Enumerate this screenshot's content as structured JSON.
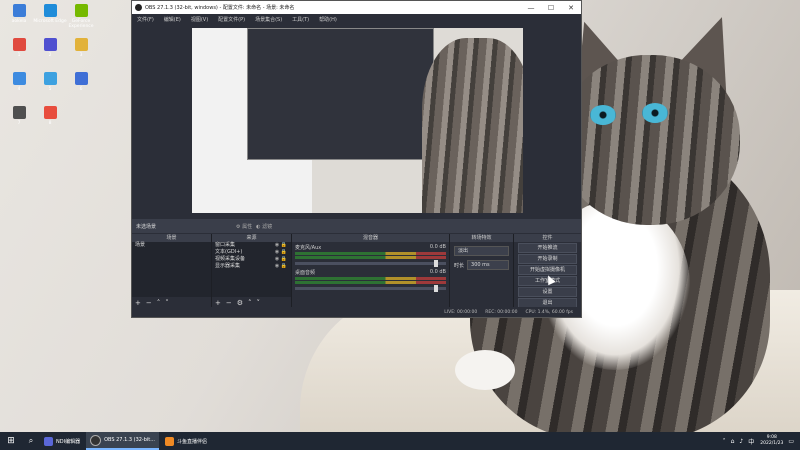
{
  "desktop": {
    "icons": [
      {
        "label": "aokela",
        "color": "#3b7dd8"
      },
      {
        "label": "Microsoft Edge",
        "color": "#1f8cd9"
      },
      {
        "label": "GeForce Experience",
        "color": "#76b900"
      },
      {
        "label": "1",
        "color": "#e04a3f"
      },
      {
        "label": "2",
        "color": "#5050d0"
      },
      {
        "label": "3",
        "color": "#e2b23a"
      },
      {
        "label": "4",
        "color": "#3d8be0"
      },
      {
        "label": "5",
        "color": "#3da1e0"
      },
      {
        "label": "6",
        "color": "#3f6fd6"
      },
      {
        "label": "7",
        "color": "#4f4f4f"
      },
      {
        "label": "8",
        "color": "#e84d3d"
      }
    ]
  },
  "obs": {
    "title": "OBS 27.1.3 (32-bit, windows) - 配置文件: 未命名 - 场景: 未命名",
    "controls": [
      "—",
      "☐",
      "✕"
    ],
    "menu": [
      "文件(F)",
      "编辑(E)",
      "视图(V)",
      "配置文件(P)",
      "场景集合(S)",
      "工具(T)",
      "帮助(H)"
    ],
    "current_scene_label": "未选场景",
    "scene_buttons": [
      "属性",
      "滤镜"
    ],
    "panels": {
      "scenes": {
        "header": "场景",
        "items": [
          "场景"
        ]
      },
      "sources": {
        "header": "来源",
        "items": [
          "窗口采集",
          "文本(GDI+)",
          "视频采集设备",
          "显示器采集"
        ]
      },
      "mixer": {
        "header": "混音器",
        "channels": [
          {
            "name": "麦克风/Aux",
            "db": "0.0 dB"
          },
          {
            "name": "桌面音频",
            "db": "0.0 dB"
          }
        ]
      },
      "transitions": {
        "header": "转场特效",
        "type": "淡出",
        "duration_label": "时长",
        "duration": "300 ms"
      },
      "controls": {
        "header": "控件",
        "buttons": [
          "开始推流",
          "开始录制",
          "开始虚拟摄像机",
          "工作室模式",
          "设置",
          "退出"
        ]
      }
    },
    "status": {
      "live": "LIVE: 00:00:00",
      "rec": "REC: 00:00:00",
      "cpu": "CPU: 1.4%, 60.00 fps"
    }
  },
  "taskbar": {
    "apps": [
      {
        "label": "NDI编辑器",
        "color": "#5a67d8",
        "active": false
      },
      {
        "label": "OBS 27.1.3 (32-bit...",
        "color": "#333333",
        "active": true
      },
      {
        "label": "斗鱼直播伴侣",
        "color": "#f08a24",
        "active": false
      }
    ],
    "time": "9:08",
    "date": "2022/1/23"
  }
}
